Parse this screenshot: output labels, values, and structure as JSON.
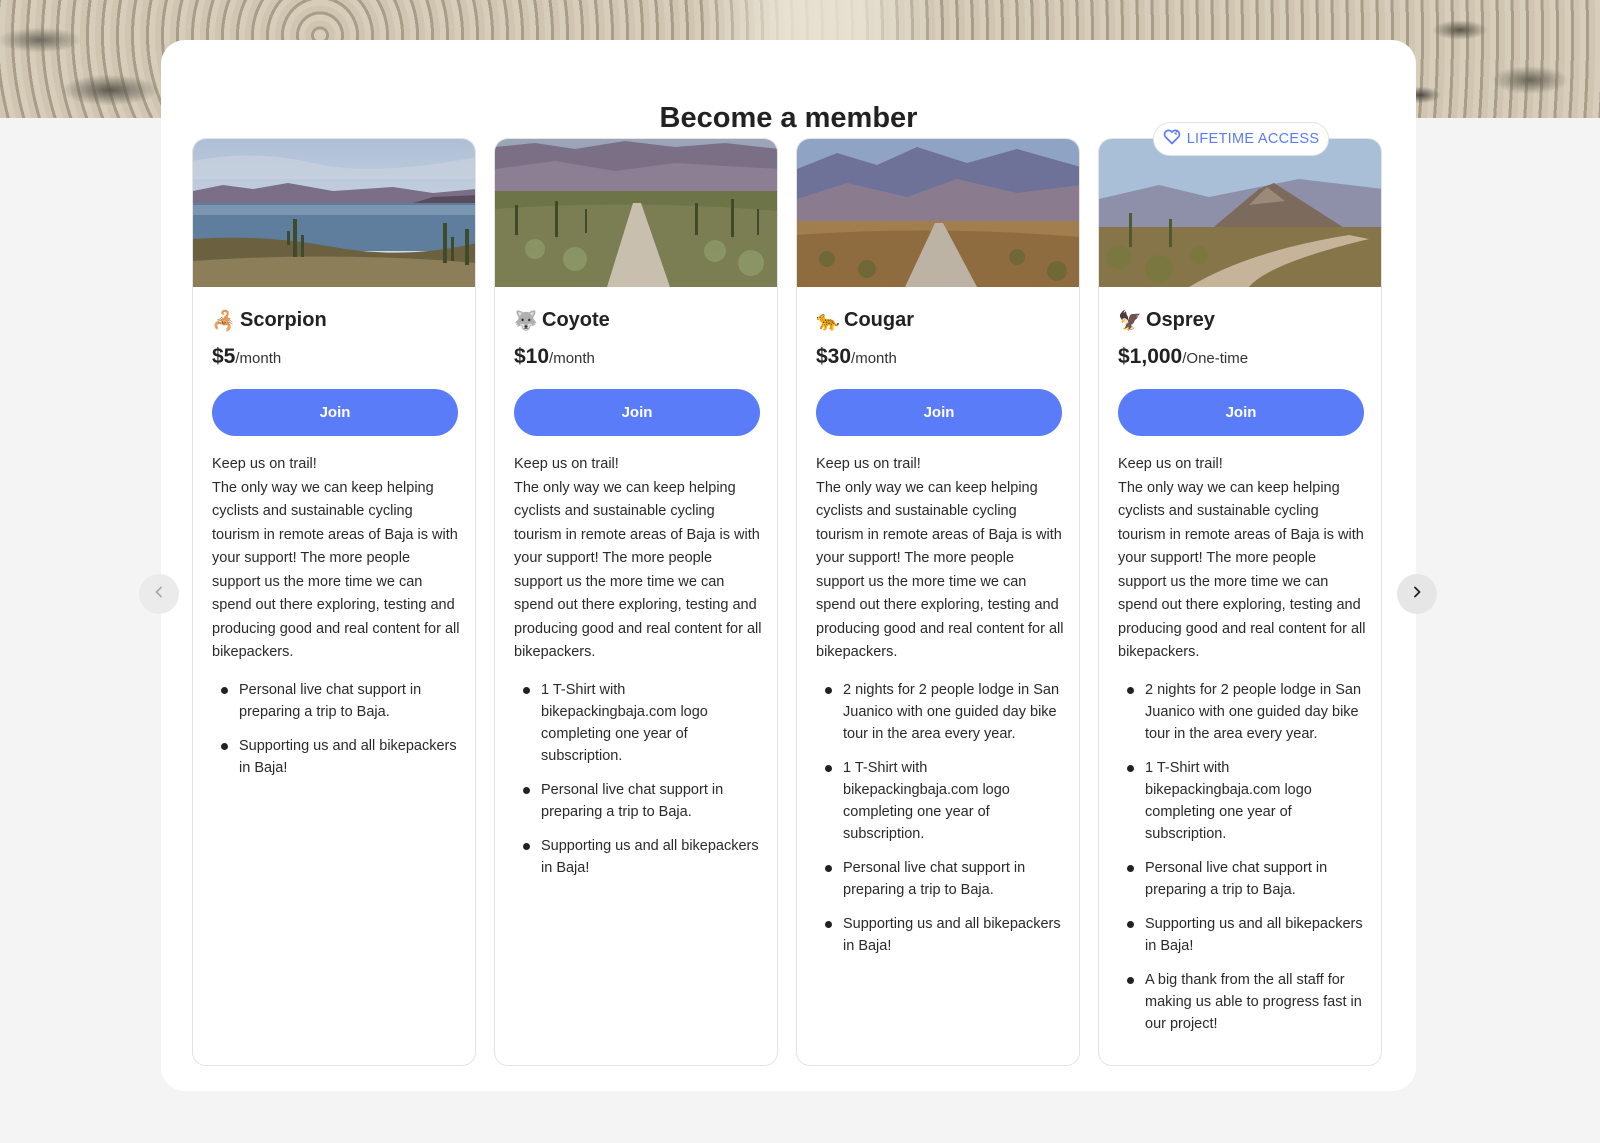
{
  "page": {
    "title": "Become a member",
    "lifetime_badge": "LIFETIME ACCESS",
    "accent_color": "#5b7cf8"
  },
  "navigation": {
    "prev_icon": "chevron-left-icon",
    "next_icon": "chevron-right-icon"
  },
  "tiers": [
    {
      "emoji": "🦂",
      "name": "Scorpion",
      "price": "$5",
      "period": "/month",
      "join_label": "Join",
      "desc_intro": "Keep us on trail!",
      "desc_body": "The only way we can keep helping cyclists and sustainable cycling tourism in remote areas of Baja is with your support! The more people support us the more time we can spend out there exploring, testing and producing good and real content for all bikepackers.",
      "perks": [
        "Personal live chat support in preparing a trip to Baja.",
        "Supporting us and all bikepackers in Baja!"
      ]
    },
    {
      "emoji": "🐺",
      "name": "Coyote",
      "price": "$10",
      "period": "/month",
      "join_label": "Join",
      "desc_intro": "Keep us on trail!",
      "desc_body": "The only way we can keep helping cyclists and sustainable cycling tourism in remote areas of Baja is with your support! The more people support us the more time we can spend out there exploring, testing and producing good and real content for all bikepackers.",
      "perks": [
        "1 T-Shirt with bikepackingbaja.com logo completing one year of subscription.",
        "Personal live chat support in preparing a trip to Baja.",
        "Supporting us and all bikepackers in Baja!"
      ]
    },
    {
      "emoji": "🐆",
      "name": "Cougar",
      "price": "$30",
      "period": "/month",
      "join_label": "Join",
      "desc_intro": "Keep us on trail!",
      "desc_body": "The only way we can keep helping cyclists and sustainable cycling tourism in remote areas of Baja is with your support! The more people support us the more time we can spend out there exploring, testing and producing good and real content for all bikepackers.",
      "perks": [
        "2 nights for 2 people lodge in San Juanico with one guided day bike tour in the area every year.",
        "1 T-Shirt with bikepackingbaja.com logo completing one year of subscription.",
        "Personal live chat support in preparing a trip to Baja.",
        "Supporting us and all bikepackers in Baja!"
      ]
    },
    {
      "emoji": "🦅",
      "name": "Osprey",
      "price": "$1,000",
      "period": "/One-time",
      "join_label": "Join",
      "desc_intro": "Keep us on trail!",
      "desc_body": "The only way we can keep helping cyclists and sustainable cycling tourism in remote areas of Baja is with your support! The more people support us the more time we can spend out there exploring, testing and producing good and real content for all bikepackers.",
      "perks": [
        "2 nights for 2 people lodge in San Juanico with one guided day bike tour in the area every year.",
        "1 T-Shirt with bikepackingbaja.com logo completing one year of subscription.",
        "Personal live chat support in preparing a trip to Baja.",
        "Supporting us and all bikepackers in Baja!",
        "A big thank from the all staff for making us able to progress fast in our project!"
      ]
    }
  ]
}
